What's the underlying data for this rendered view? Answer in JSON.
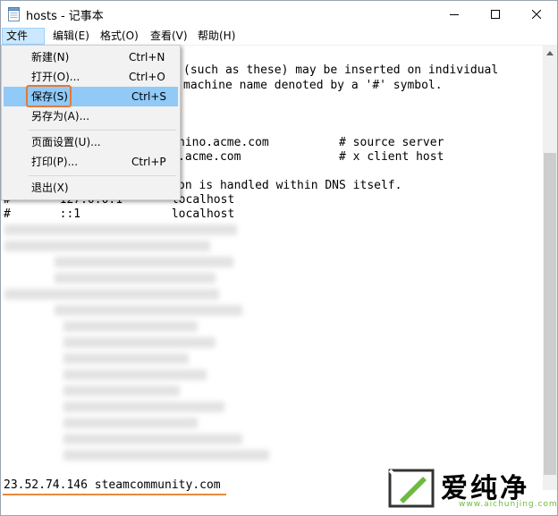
{
  "window": {
    "title": "hosts - 记事本",
    "icon": "notepad-icon",
    "controls": [
      "minimize-icon",
      "maximize-icon",
      "close-icon"
    ]
  },
  "menubar": {
    "items": [
      {
        "label": "文件(F)",
        "active": true
      },
      {
        "label": "编辑(E)"
      },
      {
        "label": "格式(O)"
      },
      {
        "label": "查看(V)"
      },
      {
        "label": "帮助(H)"
      }
    ]
  },
  "file_menu": {
    "items": [
      {
        "label": "新建(N)",
        "shortcut": "Ctrl+N"
      },
      {
        "label": "打开(O)...",
        "shortcut": "Ctrl+O"
      },
      {
        "label": "保存(S)",
        "shortcut": "Ctrl+S",
        "selected": true
      },
      {
        "label": "另存为(A)...",
        "shortcut": ""
      },
      {
        "label": "页面设置(U)...",
        "shortcut": ""
      },
      {
        "label": "打印(P)...",
        "shortcut": "Ctrl+P"
      },
      {
        "label": "退出(X)",
        "shortcut": ""
      }
    ]
  },
  "editor": {
    "lines": [
      "(such as these) may be inserted on individual",
      "machine name denoted by a '#' symbol.",
      "hino.acme.com          # source server",
      ".acme.com              # x client host",
      "on is handled within DNS itself.",
      "#       127.0.0.1       localhost",
      "#       ::1             localhost"
    ],
    "last_line": "23.52.74.146 steamcommunity.com"
  },
  "watermark": {
    "text": "爱纯净",
    "sub": "www.aichunjing.com",
    "accent_color": "#6dbb3f"
  },
  "colors": {
    "selection": "#91c9f7",
    "outline": "#e07b39",
    "underline": "#e58a3c"
  }
}
